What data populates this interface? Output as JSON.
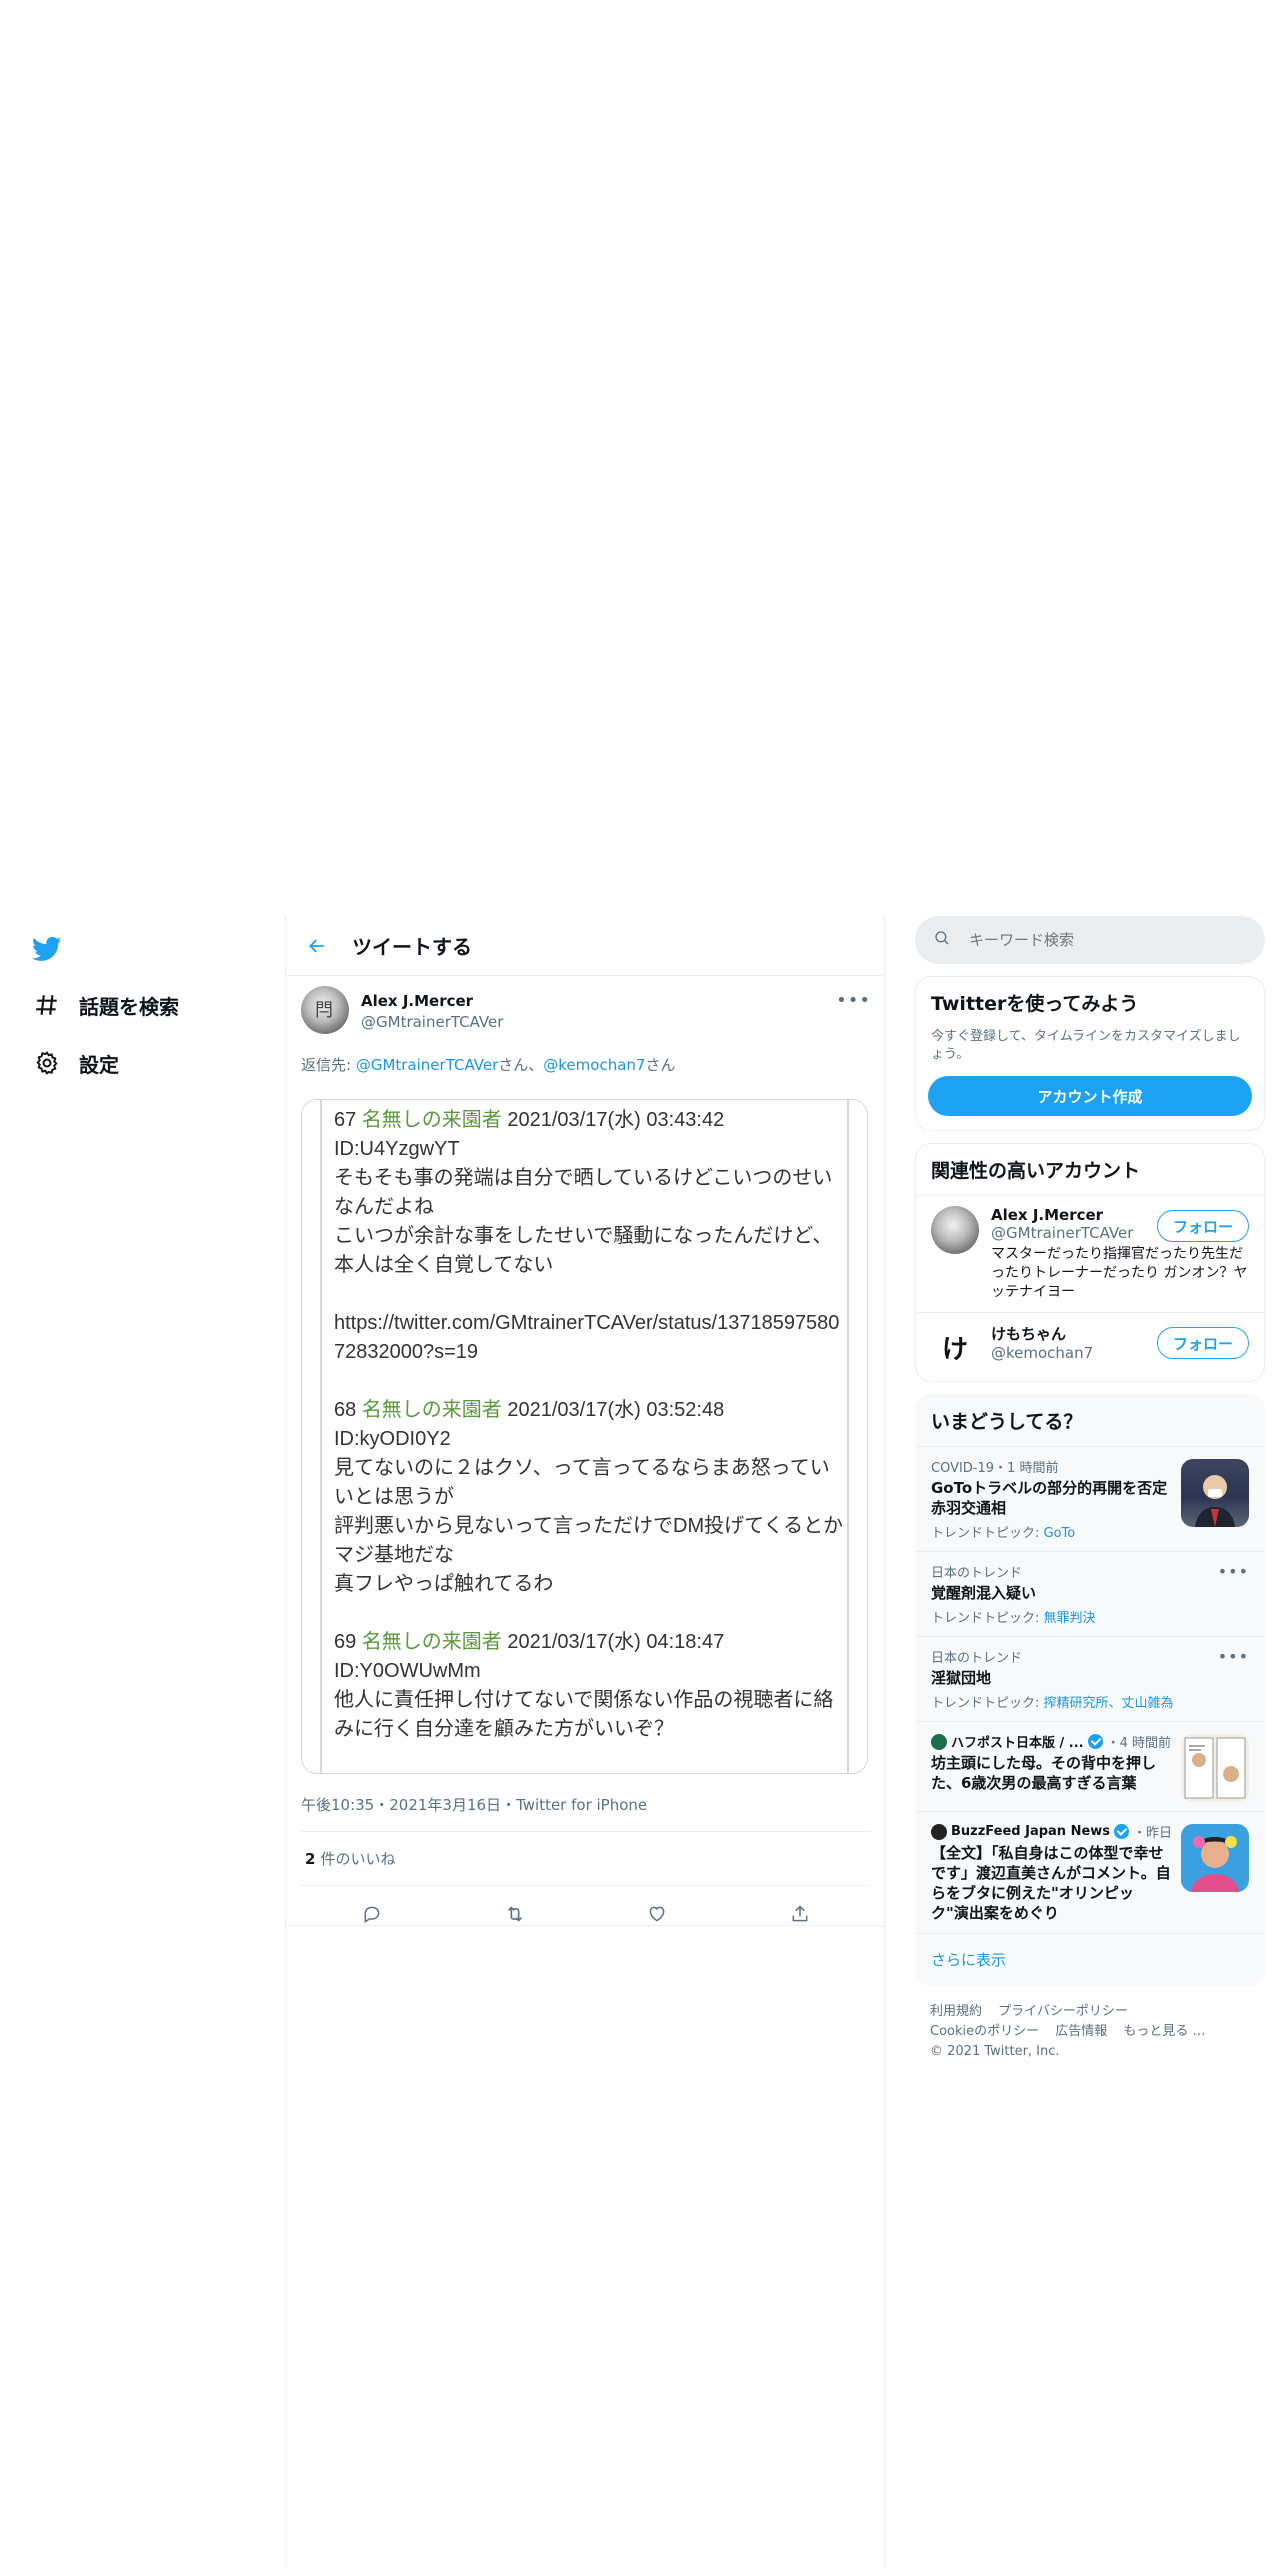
{
  "sidebar": {
    "items": [
      {
        "label": "話題を検索"
      },
      {
        "label": "設定"
      }
    ]
  },
  "header": {
    "title": "ツイートする"
  },
  "tweet": {
    "author_name": "Alex J.Mercer",
    "author_handle": "@GMtrainerTCAVer",
    "reply_prefix": "返信先: ",
    "reply_to_1": "@GMtrainerTCAVer",
    "reply_suffix_1": "さん、",
    "reply_to_2": "@kemochan7",
    "reply_suffix_2": "さん",
    "media_posts": [
      {
        "num": "67",
        "name": "名無しの来園者",
        "date": "2021/03/17(水) 03:43:42",
        "id": "ID:U4YzgwYT",
        "body": "そもそも事の発端は自分で晒しているけどこいつのせいなんだよね\nこいつが余計な事をしたせいで騒動になったんだけど、本人は全く自覚してない\n\nhttps://twitter.com/GMtrainerTCAVer/status/1371859758072832000?s=19\n\n"
      },
      {
        "num": "68",
        "name": "名無しの来園者",
        "date": "2021/03/17(水) 03:52:48",
        "id": "ID:kyODI0Y2",
        "body": "見てないのに２はクソ、って言ってるならまあ怒っていいとは思うが\n評判悪いから見ないって言っただけでDM投げてくるとかマジ基地だな\n真フレやっぱ触れてるわ\n\n"
      },
      {
        "num": "69",
        "name": "名無しの来園者",
        "date": "2021/03/17(水) 04:18:47",
        "id": "ID:Y0OWUwMm",
        "body": "他人に責任押し付けてないで関係ない作品の視聴者に絡みに行く自分達を顧みた方がいいぞ？"
      }
    ],
    "time": "午後10:35",
    "date": "2021年3月16日",
    "source": "Twitter for iPhone",
    "likes_count": "2",
    "likes_label": "件のいいね"
  },
  "right": {
    "search_placeholder": "キーワード検索",
    "signup": {
      "title": "Twitterを使ってみよう",
      "desc": "今すぐ登録して、タイムラインをカスタマイズしましょう。",
      "button": "アカウント作成"
    },
    "related": {
      "title": "関連性の高いアカウント",
      "accounts": [
        {
          "name": "Alex J.Mercer",
          "handle": "@GMtrainerTCAVer",
          "bio": "マスターだったり指揮官だったり先生だったりトレーナーだったり ガンオン？ヤッテナイヨー",
          "follow": "フォロー"
        },
        {
          "name": "けもちゃん",
          "handle": "@kemochan7",
          "avatar_char": "け",
          "follow": "フォロー"
        }
      ]
    },
    "trends": {
      "title": "いまどうしてる？",
      "items": [
        {
          "context": "COVID-19・1 時間前",
          "title": "GoToトラベルの部分的再開を否定 赤羽交通相",
          "sub_prefix": "トレンドトピック: ",
          "sub_link": "GoTo"
        },
        {
          "context": "日本のトレンド",
          "title": "覚醒剤混入疑い",
          "sub_prefix": "トレンドトピック: ",
          "sub_link": "無罪判決"
        },
        {
          "context": "日本のトレンド",
          "title": "淫獄団地",
          "sub_prefix": "トレンドトピック: ",
          "sub_link": "搾精研究所、丈山雑為"
        },
        {
          "source": "ハフポスト日本版 / ...",
          "time": "・4 時間前",
          "title": "坊主頭にした母。その背中を押した、6歳次男の最高すぎる言葉"
        },
        {
          "source": "BuzzFeed Japan News",
          "time": "・昨日",
          "title": "【全文】「私自身はこの体型で幸せです」渡辺直美さんがコメント。自らをブタに例えた\"オリンピック\"演出案をめぐり"
        }
      ],
      "show_more": "さらに表示"
    },
    "footer": {
      "links": [
        "利用規約",
        "プライバシーポリシー",
        "Cookieのポリシー",
        "広告情報",
        "もっと見る …"
      ],
      "copyright": "© 2021 Twitter, Inc."
    }
  },
  "colors": {
    "accent": "#1da1f2",
    "link": "#1b95e0",
    "text": "#0f1419",
    "muted": "#5b7083",
    "post_name": "#5a9a3a"
  }
}
